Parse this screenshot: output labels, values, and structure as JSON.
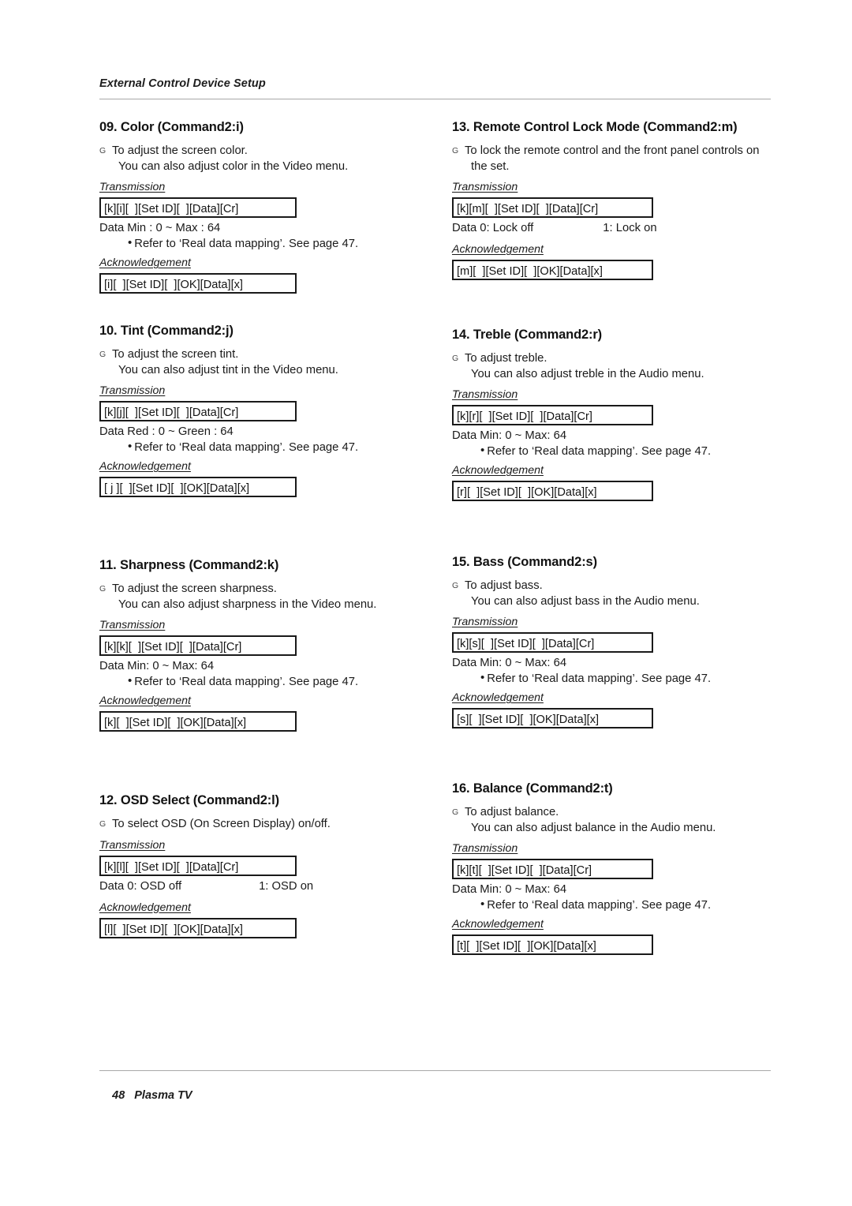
{
  "header": {
    "running_title": "External Control Device Setup"
  },
  "footer": {
    "page_number": "48",
    "product": "Plasma TV"
  },
  "labels": {
    "transmission": "Transmission",
    "acknowledgement": "Acknowledgement",
    "data": "Data",
    "bullet_marker": "G",
    "refer_bullet": "•"
  },
  "left_column": [
    {
      "title": "09. Color (Command2:i)",
      "desc_line1": "To adjust the screen color.",
      "desc_line2": "You can also adjust color in the Video menu.",
      "transmission_code": "[k][i][  ][Set ID][  ][Data][Cr]",
      "data_value": "Min : 0 ~ Max : 64",
      "data_value2": "",
      "refer": "Refer to ‘Real data mapping’. See page 47.",
      "ack_code": "[i][  ][Set ID][  ][OK][Data][x]"
    },
    {
      "title": "10. Tint (Command2:j)",
      "desc_line1": "To adjust the screen tint.",
      "desc_line2": "You can also adjust tint in the Video menu.",
      "transmission_code": "[k][j][  ][Set ID][  ][Data][Cr]",
      "data_value": "Red : 0 ~ Green : 64",
      "data_value2": "",
      "refer": "Refer to ‘Real data mapping’. See page 47.",
      "ack_code": "[ j ][  ][Set ID][  ][OK][Data][x]"
    },
    {
      "title": "11. Sharpness (Command2:k)",
      "desc_line1": "To adjust the screen sharpness.",
      "desc_line2": "You can also adjust sharpness in the Video menu.",
      "transmission_code": "[k][k][  ][Set ID][  ][Data][Cr]",
      "data_value": "Min: 0 ~ Max: 64",
      "data_value2": "",
      "refer": "Refer to ‘Real data mapping’. See page 47.",
      "ack_code": "[k][  ][Set ID][  ][OK][Data][x]"
    },
    {
      "title": "12. OSD Select (Command2:l)",
      "desc_line1": "To select OSD (On Screen Display) on/off.",
      "desc_line2": "",
      "transmission_code": "[k][l][  ][Set ID][  ][Data][Cr]",
      "data_value": "0: OSD off",
      "data_value2": "1: OSD on",
      "refer": "",
      "ack_code": "[l][  ][Set ID][  ][OK][Data][x]"
    }
  ],
  "right_column": [
    {
      "title": "13. Remote Control Lock Mode (Command2:m)",
      "desc_line1": "To lock the remote control and the front panel controls on",
      "desc_line2": "the set.",
      "transmission_code": "[k][m][  ][Set ID][  ][Data][Cr]",
      "data_value": "0: Lock off",
      "data_value2": "1: Lock on",
      "refer": "",
      "ack_code": "[m][  ][Set ID][  ][OK][Data][x]"
    },
    {
      "title": "14. Treble (Command2:r)",
      "desc_line1": "To adjust treble.",
      "desc_line2": "You can also adjust treble in the Audio menu.",
      "transmission_code": "[k][r][  ][Set ID][  ][Data][Cr]",
      "data_value": "Min: 0 ~ Max: 64",
      "data_value2": "",
      "refer": "Refer to ‘Real data mapping’. See page 47.",
      "ack_code": "[r][  ][Set ID][  ][OK][Data][x]"
    },
    {
      "title": "15. Bass (Command2:s)",
      "desc_line1": "To adjust bass.",
      "desc_line2": "You can also adjust bass in the Audio menu.",
      "transmission_code": "[k][s][  ][Set ID][  ][Data][Cr]",
      "data_value": "Min: 0 ~ Max: 64",
      "data_value2": "",
      "refer": "Refer to ‘Real data mapping’. See page 47.",
      "ack_code": "[s][  ][Set ID][  ][OK][Data][x]"
    },
    {
      "title": "16. Balance (Command2:t)",
      "desc_line1": "To adjust balance.",
      "desc_line2": "You can also adjust balance in the Audio menu.",
      "transmission_code": "[k][t][  ][Set ID][  ][Data][Cr]",
      "data_value": "Min: 0 ~ Max: 64",
      "data_value2": "",
      "refer": "Refer to ‘Real data mapping’. See page 47.",
      "ack_code": "[t][  ][Set ID][  ][OK][Data][x]"
    }
  ],
  "layout": {
    "left_tops": [
      152,
      410,
      707,
      1005
    ],
    "right_tops": [
      152,
      415,
      703,
      990
    ]
  }
}
